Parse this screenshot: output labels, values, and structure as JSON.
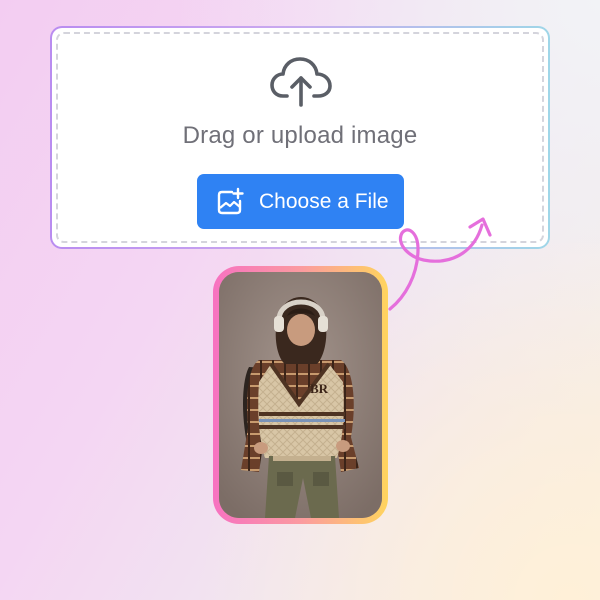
{
  "upload": {
    "prompt": "Drag or upload image",
    "button_label": "Choose a File",
    "icon": "cloud-upload-icon",
    "button_icon": "add-image-icon"
  },
  "colors": {
    "button": "#2f82f3",
    "arrow": "#e56fdc",
    "frame_start": "#f772c1",
    "frame_end": "#ffd45e",
    "card_border_start": "#b98cf0",
    "card_border_end": "#9fd6e8"
  },
  "photo": {
    "subject": "person in cable-knit sweater vest with headphones",
    "vest_monogram": "BR"
  }
}
